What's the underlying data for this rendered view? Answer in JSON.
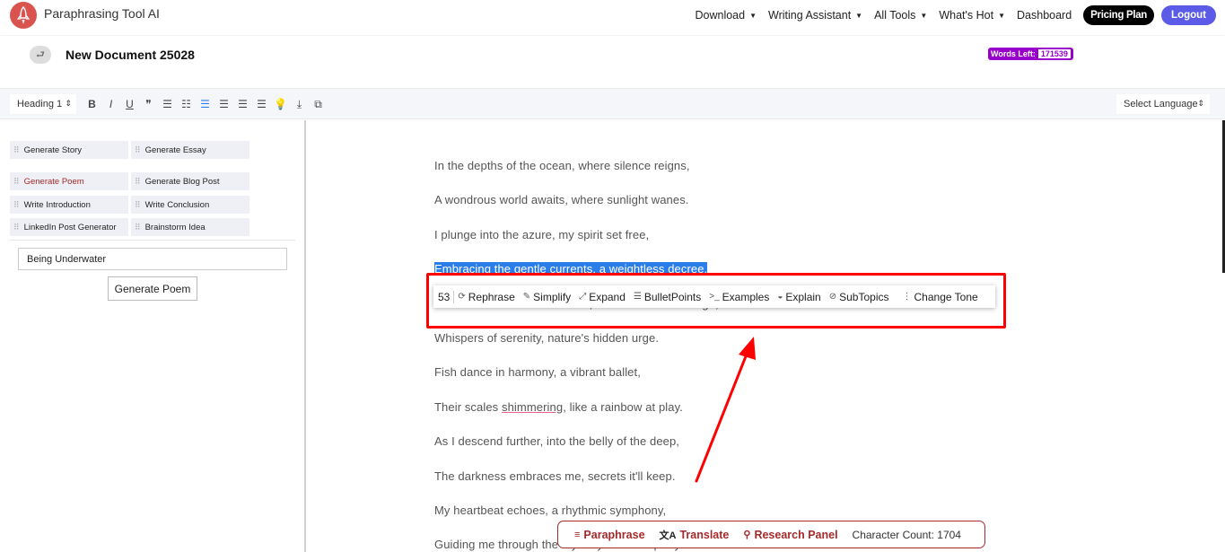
{
  "app": {
    "brand": "Paraphrasing Tool AI",
    "logo_icon": "rocket-icon",
    "menu": [
      {
        "label": "Download",
        "has_caret": true
      },
      {
        "label": "Writing Assistant",
        "has_caret": true
      },
      {
        "label": "All Tools",
        "has_caret": true
      },
      {
        "label": "What's Hot",
        "has_caret": true
      },
      {
        "label": "Dashboard",
        "has_caret": false
      }
    ],
    "pricing_label": "Pricing Plan",
    "logout_label": "Logout",
    "caret_glyph": "▼"
  },
  "document": {
    "title": "New Document 25028",
    "words_left_label": "Words Left:",
    "words_left_value": "171539"
  },
  "toolbar": {
    "heading_value": "Heading 1",
    "language_value": "Select Language",
    "select_arrow": "⇕",
    "icons": [
      {
        "name": "bold-icon",
        "glyph": "B",
        "active": false
      },
      {
        "name": "italic-icon",
        "glyph": "I",
        "active": false
      },
      {
        "name": "underline-icon",
        "glyph": "U",
        "active": false
      },
      {
        "name": "quote-icon",
        "glyph": "❞",
        "active": false
      },
      {
        "name": "ordered-list-icon",
        "glyph": "☰",
        "active": false
      },
      {
        "name": "bullet-list-icon",
        "glyph": "☷",
        "active": false
      },
      {
        "name": "align-left-icon",
        "glyph": "☰",
        "active": true
      },
      {
        "name": "align-center-icon",
        "glyph": "☰",
        "active": false
      },
      {
        "name": "align-right-icon",
        "glyph": "☰",
        "active": false
      },
      {
        "name": "align-justify-icon",
        "glyph": "☰",
        "active": false
      },
      {
        "name": "lightbulb-icon",
        "glyph": "💡",
        "active": false
      },
      {
        "name": "download-icon",
        "glyph": "⤓",
        "active": false
      },
      {
        "name": "copy-icon",
        "glyph": "⧉",
        "active": false
      }
    ]
  },
  "sidebar": {
    "tools": [
      {
        "label": "Generate Story",
        "selected": false
      },
      {
        "label": "Generate Essay",
        "selected": false
      },
      {
        "label": "Generate Poem",
        "selected": true
      },
      {
        "label": "Generate Blog Post",
        "selected": false
      },
      {
        "label": "Write Introduction",
        "selected": false
      },
      {
        "label": "Write Conclusion",
        "selected": false
      },
      {
        "label": "LinkedIn Post Generator",
        "selected": false
      },
      {
        "label": "Brainstorm Idea",
        "selected": false
      }
    ],
    "grip_glyph": "⠿",
    "topic_value": "Being Underwater",
    "generate_label": "Generate Poem"
  },
  "editor": {
    "lines": [
      "In the depths of the ocean, where silence reigns,",
      "A wondrous world awaits, where sunlight wanes.",
      "I plunge into the azure, my spirit set free,",
      "Embracing the gentle currents, a weightless decree.",
      "Beneath the cerulean surface, where colors converge,",
      "Whispers of serenity, nature's hidden urge.",
      "Fish dance in harmony, a vibrant ballet,",
      "Their scales shimmering, like a rainbow at play.",
      "As I descend further, into the belly of the deep,",
      "The darkness embraces me, secrets it'll keep.",
      "My heartbeat echoes, a rhythmic symphony,",
      "Guiding me through the mystery and tranquility."
    ],
    "selected_line_index": 3,
    "spell_word": "shimmering"
  },
  "ai_popup": {
    "count": "53",
    "actions": [
      {
        "label": "Rephrase",
        "icon": "rephrase-icon",
        "glyph": "⟳"
      },
      {
        "label": "Simplify",
        "icon": "pencil-icon",
        "glyph": "✎"
      },
      {
        "label": "Expand",
        "icon": "expand-icon",
        "glyph": "⤢"
      },
      {
        "label": "BulletPoints",
        "icon": "list-icon",
        "glyph": "☰"
      },
      {
        "label": "Examples",
        "icon": "terminal-icon",
        "glyph": ">_"
      },
      {
        "label": "Explain",
        "icon": "graduation-icon",
        "glyph": "◒"
      },
      {
        "label": "SubTopics",
        "icon": "subtopics-icon",
        "glyph": "⊘"
      },
      {
        "label": "Change Tone",
        "icon": "more-vertical-icon",
        "glyph": "⋮"
      }
    ]
  },
  "bottom_bar": {
    "actions": [
      {
        "label": "Paraphrase",
        "icon": "paraphrase-icon",
        "glyph": "≡"
      },
      {
        "label": "Translate",
        "icon": "translate-icon",
        "glyph": "文A"
      },
      {
        "label": "Research Panel",
        "icon": "search-icon",
        "glyph": "⚲"
      }
    ],
    "char_count_label": "Character Count:",
    "char_count_value": "1704"
  },
  "annotation": {
    "box_color": "#ff0000",
    "arrow_color": "#ff0000"
  },
  "colors": {
    "brand_red": "#d9534f",
    "accent_maroon": "#a52a2a",
    "words_left_purple": "#9900cc",
    "logout_blue": "#5b5be8",
    "selection_blue": "#2b7de9"
  }
}
